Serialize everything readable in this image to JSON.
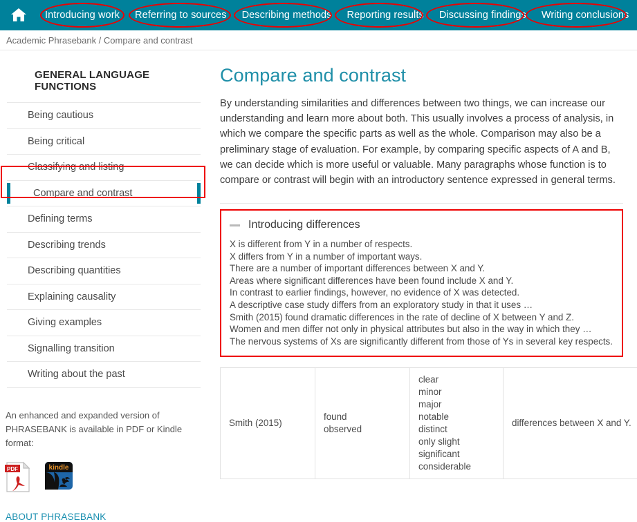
{
  "topnav": {
    "home_icon": "home-icon",
    "links": [
      "Introducing work",
      "Referring to sources",
      "Describing methods",
      "Reporting results",
      "Discussing findings",
      "Writing conclusions"
    ]
  },
  "breadcrumb": "Academic Phrasebank / Compare and contrast",
  "sidebar": {
    "title": "GENERAL LANGUAGE FUNCTIONS",
    "items": [
      "Being cautious",
      "Being critical",
      "Classifying and listing",
      "Compare and contrast",
      "Defining terms",
      "Describing trends",
      "Describing quantities",
      "Explaining causality",
      "Giving examples",
      "Signalling transition",
      "Writing about the past"
    ],
    "selected_index": 3,
    "promo_line1": "An enhanced and expanded version of",
    "promo_line2": "PHRASEBANK is available in PDF or Kindle format:",
    "pdf_icon_label": "PDF",
    "kindle_icon_label": "kindle",
    "about_link": "ABOUT PHRASEBANK"
  },
  "main": {
    "title": "Compare and contrast",
    "intro": "By understanding similarities and differences between two things, we can increase our understanding and learn more about both. This usually involves a process of analysis, in which we compare the specific parts as well as the whole. Comparison may also be a preliminary stage of evaluation. For example, by comparing specific aspects of A and B, we can decide which is more useful or valuable. Many paragraphs whose function is to compare or contrast will begin with an introductory sentence expressed in general terms.",
    "accordion": {
      "heading": "Introducing differences",
      "toggle_icon": "minus-icon",
      "phrases": [
        "X is different from Y in a number of respects.",
        "X differs from Y in a number of important ways.",
        "There are a number of important differences between X and Y.",
        "Areas where significant differences have been found include X and Y.",
        "In contrast to earlier findings, however, no evidence of X was detected.",
        "A descriptive case study differs from an exploratory study in that it uses …",
        "Smith (2015) found dramatic differences in the rate of decline of X between Y and Z.",
        "Women and men differ not only in physical attributes but also in the way in which they …",
        "The nervous systems of Xs are significantly different from those of Ys in several key respects."
      ]
    },
    "table": {
      "rows": [
        {
          "col1": [
            "Smith (2015)"
          ],
          "col2": [
            "found",
            "observed"
          ],
          "col3": [
            "clear",
            "minor",
            "major",
            "notable",
            "distinct",
            "only slight",
            "significant",
            "considerable"
          ],
          "col4": [
            "differences between X and Y."
          ]
        }
      ]
    }
  },
  "colors": {
    "teal": "#00819b",
    "heading_teal": "#1f8fa8",
    "annotation_red": "#ee0000",
    "link_blue": "#1a8fb0"
  }
}
